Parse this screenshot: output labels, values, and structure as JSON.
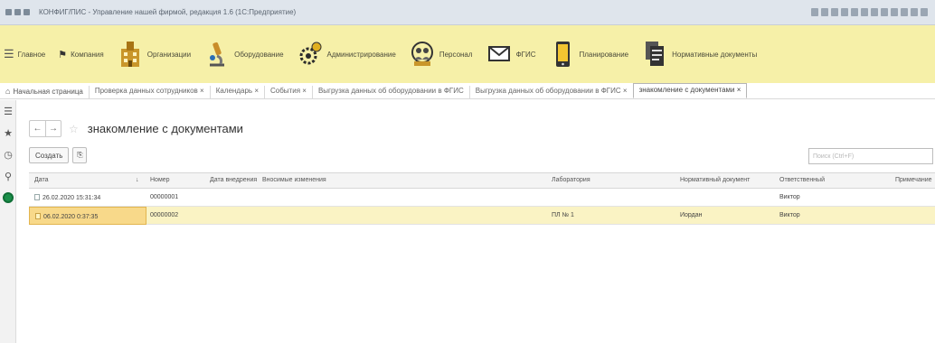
{
  "window": {
    "title": "КОНФИГ/ПИС - Управление нашей фирмой, редакция 1.6 (1С:Предприятие)"
  },
  "toolbar": {
    "items": [
      {
        "label": "Главное",
        "icon": "menu-icon"
      },
      {
        "label": "Компания",
        "icon": "flag-icon"
      },
      {
        "label": "Организации",
        "icon": "building-icon"
      },
      {
        "label": "Оборудование",
        "icon": "microscope-icon"
      },
      {
        "label": "Администрирование",
        "icon": "gear-icon"
      },
      {
        "label": "Персонал",
        "icon": "people-icon"
      },
      {
        "label": "ФГИС",
        "icon": "envelope-icon"
      },
      {
        "label": "Планирование",
        "icon": "phone-icon"
      },
      {
        "label": "Нормативные документы",
        "icon": "documents-icon"
      }
    ]
  },
  "tabs": {
    "home": "Начальная страница",
    "items": [
      "Проверка данных сотрудников",
      "Календарь",
      "События",
      "Выгрузка данных об оборудовании в ФГИС",
      "Выгрузка данных об оборудовании в ФГИС",
      "знакомление с документами"
    ]
  },
  "document": {
    "title": "знакомление с документами"
  },
  "actions": {
    "create_label": "Создать",
    "search_placeholder": "Поиск (Ctrl+F)"
  },
  "table": {
    "columns": [
      "Дата",
      "Номер",
      "Дата внедрения",
      "Вносимые изменения",
      "Лаборатория",
      "Нормативный документ",
      "Ответственный",
      "Примечание"
    ],
    "rows": [
      {
        "date": "26.02.2020 15:31:34",
        "number": "00000001",
        "date_impl": "",
        "changes": "",
        "lab": "",
        "norm_doc": "",
        "responsible": "Виктор",
        "note": "",
        "selected": false
      },
      {
        "date": "06.02.2020 0:37:35",
        "number": "00000002",
        "date_impl": "",
        "changes": "",
        "lab": "ПЛ № 1",
        "norm_doc": "Иордан",
        "responsible": "Виктор",
        "note": "",
        "selected": true
      }
    ]
  },
  "colors": {
    "toolbar_bg": "#f6f0a8",
    "selected_row": "#faf3c4",
    "selected_cell": "#f8d98a",
    "accent_green": "#1b8f4a"
  }
}
